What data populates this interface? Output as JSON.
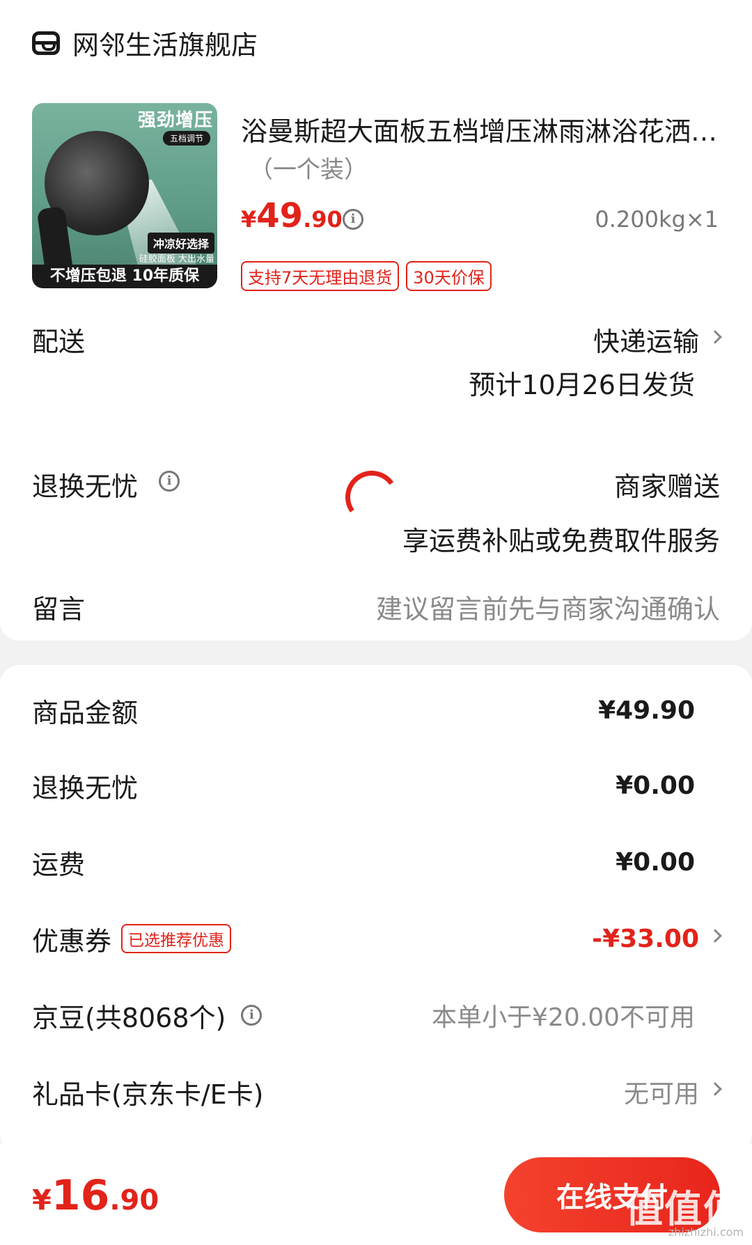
{
  "store": {
    "name": "网邻生活旗舰店",
    "icon": "store-icon"
  },
  "product": {
    "image_text": {
      "headline": "强劲增压",
      "mode": "五档调节",
      "choice": "冲凉好选择",
      "features": "硅胶面板 大出水量",
      "guarantee": "不增压包退 10年质保"
    },
    "title": "浴曼斯超大面板五档增压淋雨淋浴花洒喷头",
    "spec": "（一个装）",
    "price_currency": "¥",
    "price_int": "49",
    "price_dec": ".90",
    "weight_qty": "0.200kg×1",
    "badges": [
      "支持7天无理由退货",
      "30天价保"
    ]
  },
  "delivery": {
    "label": "配送",
    "method": "快递运输",
    "date": "预计10月26日发货"
  },
  "returns": {
    "label": "退换无忧",
    "value": "商家赠送",
    "desc": "享运费补贴或免费取件服务"
  },
  "message": {
    "label": "留言",
    "placeholder": "建议留言前先与商家沟通确认"
  },
  "summary": {
    "goods": {
      "label": "商品金额",
      "value": "¥49.90"
    },
    "returns": {
      "label": "退换无忧",
      "value": "¥0.00"
    },
    "shipping": {
      "label": "运费",
      "value": "¥0.00"
    },
    "coupon": {
      "label": "优惠券",
      "tag": "已选推荐优惠",
      "value": "-¥33.00"
    },
    "jingdou": {
      "label": "京豆(共8068个)",
      "value": "本单小于¥20.00不可用"
    },
    "giftcard": {
      "label": "礼品卡(京东卡/E卡)",
      "value": "无可用"
    }
  },
  "footer": {
    "currency": "¥",
    "total_int": "16",
    "total_dec": ".90",
    "pay_label": "在线支付"
  },
  "watermark": {
    "text": "值值值",
    "url": "zhizhizhi.com"
  },
  "colors": {
    "accent": "#e2231a",
    "background": "#f2f2f2"
  }
}
